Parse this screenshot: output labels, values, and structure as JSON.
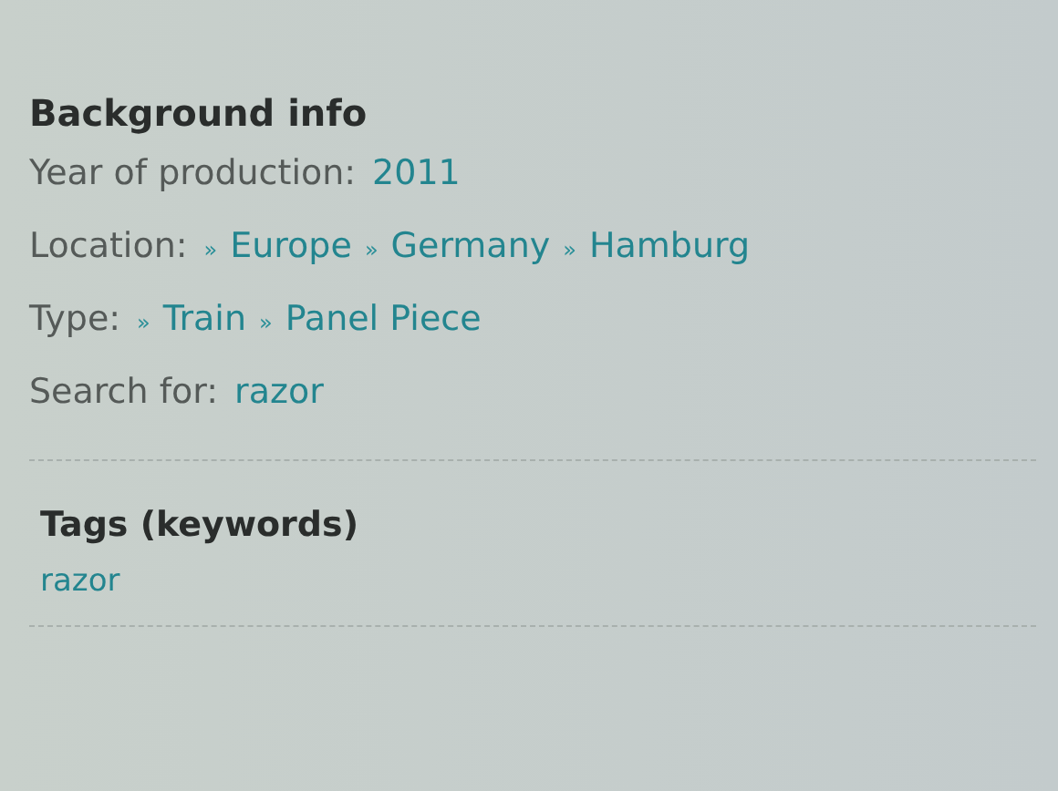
{
  "background_info": {
    "heading": "Background info",
    "rows": [
      {
        "label": "Year of production:",
        "links": [
          {
            "text": "2011"
          }
        ]
      },
      {
        "label": "Location:",
        "links": [
          {
            "marker": "»",
            "text": "Europe"
          },
          {
            "marker": "»",
            "text": "Germany"
          },
          {
            "marker": "»",
            "text": "Hamburg"
          }
        ]
      },
      {
        "label": "Type:",
        "links": [
          {
            "marker": "»",
            "text": "Train"
          },
          {
            "marker": "»",
            "text": "Panel Piece"
          }
        ]
      },
      {
        "label": "Search for:",
        "links": [
          {
            "text": "razor"
          }
        ]
      }
    ]
  },
  "tags": {
    "heading": "Tags (keywords)",
    "items": [
      "razor"
    ]
  }
}
